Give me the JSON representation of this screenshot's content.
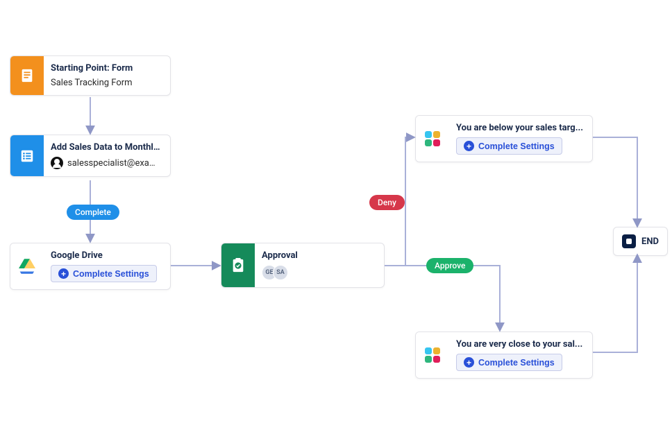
{
  "nodes": {
    "form": {
      "title": "Starting Point: Form",
      "subtitle": "Sales Tracking Form",
      "accent": "#f3901d"
    },
    "task": {
      "title": "Add Sales Data to Monthly R...",
      "assignee": "salesspecialist@exam...",
      "accent": "#1f8fe8"
    },
    "drive": {
      "title": "Google Drive",
      "button": "Complete Settings"
    },
    "approval": {
      "title": "Approval",
      "avatars": [
        "GE",
        "SA"
      ],
      "accent": "#158a5a"
    },
    "slack_below": {
      "title": "You are below your sales targ...",
      "button": "Complete Settings"
    },
    "slack_close": {
      "title": "You are very close to your sal...",
      "button": "Complete Settings"
    },
    "end": {
      "label": "END"
    }
  },
  "edges": {
    "complete": "Complete",
    "deny": "Deny",
    "approve": "Approve"
  },
  "colors": {
    "connector": "#a9b0d8",
    "arrow": "#8f97c6"
  }
}
